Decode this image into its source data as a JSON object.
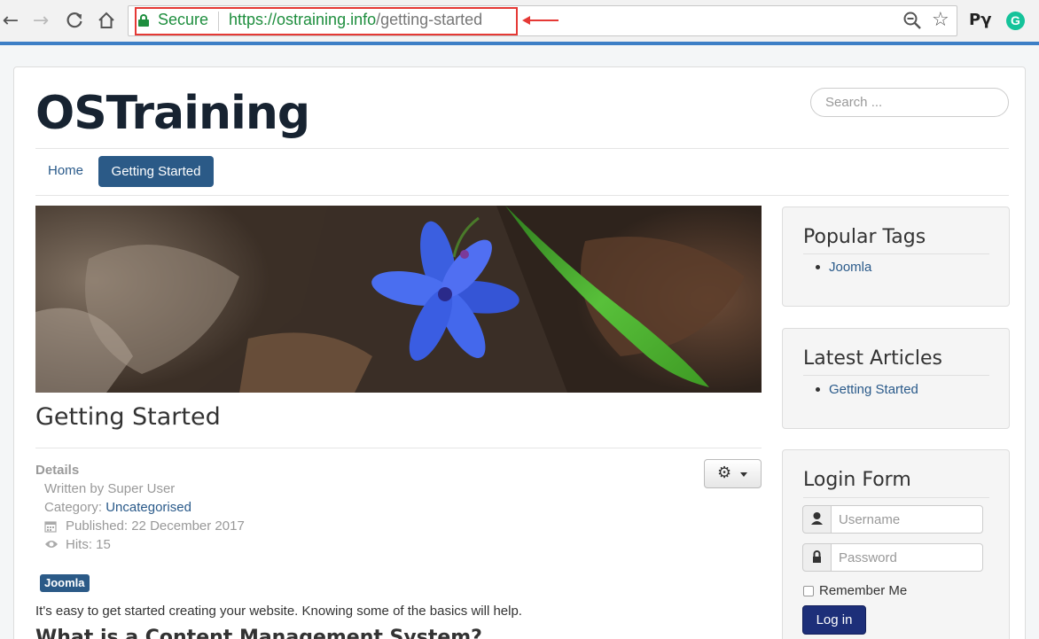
{
  "browser": {
    "security_label": "Secure",
    "url_base": "https://ostraining.info",
    "url_path": "/getting-started",
    "profile_extension_label": "Pγ",
    "grammarly_label": "G"
  },
  "site": {
    "brand": "OSTraining",
    "search_placeholder": "Search ..."
  },
  "nav": {
    "items": [
      {
        "label": "Home"
      },
      {
        "label": "Getting Started"
      }
    ]
  },
  "article": {
    "title": "Getting Started",
    "details_label": "Details",
    "author": "Written by Super User",
    "category_label": "Category:",
    "category_value": "Uncategorised",
    "published": "Published: 22 December 2017",
    "hits": "Hits: 15",
    "tag": "Joomla",
    "intro": "It's easy to get started creating your website. Knowing some of the basics will help.",
    "subheading": "What is a Content Management System?"
  },
  "sidebar": {
    "popular_tags": {
      "title": "Popular Tags",
      "items": [
        "Joomla"
      ]
    },
    "latest_articles": {
      "title": "Latest Articles",
      "items": [
        "Getting Started"
      ]
    },
    "login": {
      "title": "Login Form",
      "username_placeholder": "Username",
      "password_placeholder": "Password",
      "remember_label": "Remember Me",
      "submit_label": "Log in"
    }
  },
  "colors": {
    "link": "#2a5a8a",
    "primary_button": "#2b5a87",
    "login_button": "#1d2f79",
    "secure_green": "#1e8e3e",
    "annotation_red": "#e53935"
  }
}
